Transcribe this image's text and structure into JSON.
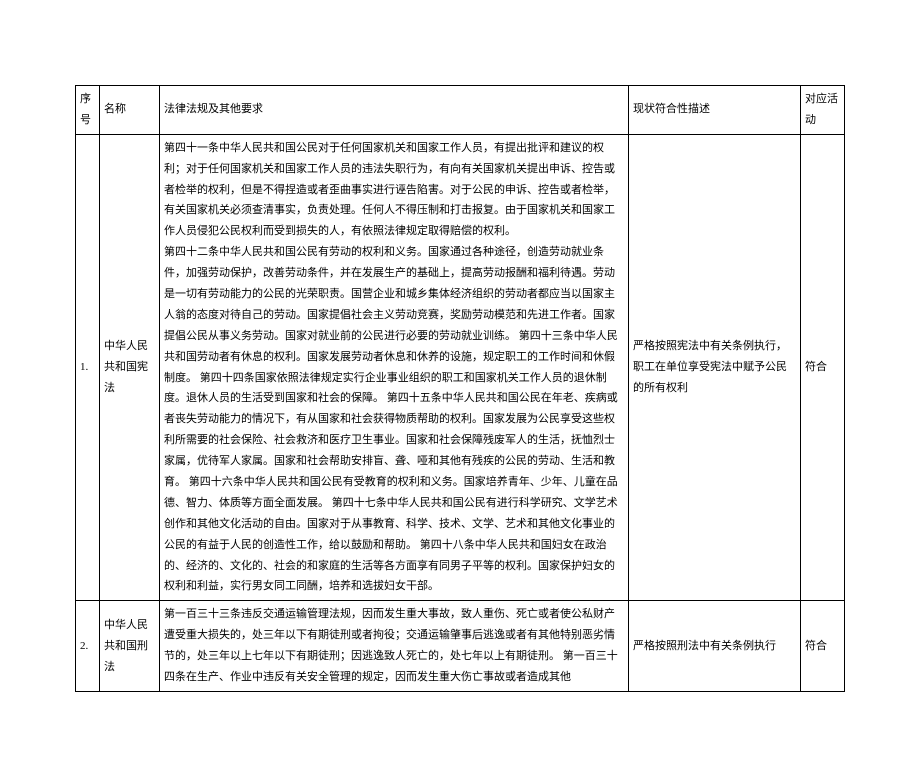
{
  "headers": {
    "seq": "序号",
    "name": "名称",
    "content": "法律法规及其他要求",
    "status": "现状符合性描述",
    "action": "对应活动"
  },
  "rows": [
    {
      "seq": "1.",
      "name": "中华人民共和国宪法",
      "content": "第四十一条中华人民共和国公民对于任何国家机关和国家工作人员，有提出批评和建议的权利；对于任何国家机关和国家工作人员的违法失职行为，有向有关国家机关提出申诉、控告或者检举的权利，但是不得捏造或者歪曲事实进行诬告陷害。对于公民的申诉、控告或者检举，有关国家机关必须查清事实，负责处理。任何人不得压制和打击报复。由于国家机关和国家工作人员侵犯公民权利而受到损失的人，有依照法律规定取得赔偿的权利。　　　　　　　　　　　　　第四十二条中华人民共和国公民有劳动的权利和义务。国家通过各种途径，创造劳动就业条件，加强劳动保护，改善劳动条件，并在发展生产的基础上，提高劳动报酬和福利待遇。劳动是一切有劳动能力的公民的光荣职责。国营企业和城乡集体经济组织的劳动者都应当以国家主人翁的态度对待自己的劳动。国家提倡社会主义劳动竞赛，奖励劳动模范和先进工作者。国家提倡公民从事义务劳动。国家对就业前的公民进行必要的劳动就业训练。\n第四十三条中华人民共和国劳动者有休息的权利。国家发展劳动者休息和休养的设施，规定职工的工作时间和休假制度。\n第四十四条国家依照法律规定实行企业事业组织的职工和国家机关工作人员的退休制度。退休人员的生活受到国家和社会的保障。\n第四十五条中华人民共和国公民在年老、疾病或者丧失劳动能力的情况下，有从国家和社会获得物质帮助的权利。国家发展为公民享受这些权利所需要的社会保险、社会救济和医疗卫生事业。国家和社会保障残废军人的生活，抚恤烈士家属，优待军人家属。国家和社会帮助安排盲、聋、哑和其他有残疾的公民的劳动、生活和教育。\n第四十六条中华人民共和国公民有受教育的权利和义务。国家培养青年、少年、儿童在品德、智力、体质等方面全面发展。\n第四十七条中华人民共和国公民有进行科学研究、文学艺术创作和其他文化活动的自由。国家对于从事教育、科学、技术、文学、艺术和其他文化事业的公民的有益于人民的创造性工作，给以鼓励和帮助。\n第四十八条中华人民共和国妇女在政治的、经济的、文化的、社会的和家庭的生活等各方面享有同男子平等的权利。国家保护妇女的权利和利益，实行男女同工同酬，培养和选拔妇女干部。",
      "status": "严格按照宪法中有关条例执行，职工在单位享受宪法中赋予公民的所有权利",
      "action": "符合"
    },
    {
      "seq": "2.",
      "name": "中华人民共和国刑法",
      "content": "第一百三十三条违反交通运输管理法规，因而发生重大事故，致人重伤、死亡或者使公私财产遭受重大损失的，处三年以下有期徒刑或者拘役；交通运输肇事后逃逸或者有其他特别恶劣情节的，处三年以上七年以下有期徒刑；因逃逸致人死亡的，处七年以上有期徒刑。\n第一百三十四条在生产、作业中违反有关安全管理的规定，因而发生重大伤亡事故或者造成其他",
      "status": "严格按照刑法中有关条例执行",
      "action": "符合"
    }
  ]
}
